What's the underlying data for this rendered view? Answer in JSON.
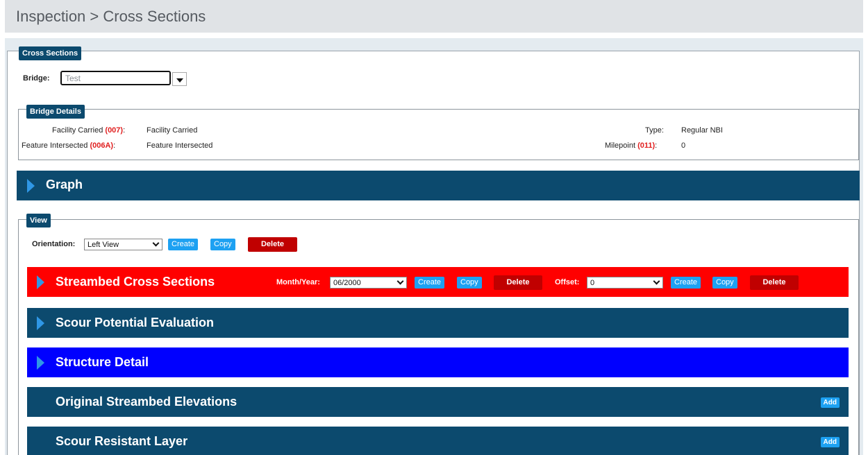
{
  "breadcrumb": "Inspection > Cross Sections",
  "cross_sections": {
    "legend": "Cross Sections",
    "bridge_label": "Bridge:",
    "bridge_value": "Test"
  },
  "bridge_details": {
    "legend": "Bridge Details",
    "facility_carried_label": "Facility Carried ",
    "facility_carried_code": "(007)",
    "facility_carried_value": "Facility Carried",
    "feature_intersected_label": "Feature Intersected ",
    "feature_intersected_code": "(006A)",
    "feature_intersected_value": "Feature Intersected",
    "type_label": "Type:",
    "type_value": "Regular NBI",
    "milepoint_label": "Milepoint ",
    "milepoint_code": "(011)",
    "milepoint_value": "0",
    "colon": ":"
  },
  "graph": {
    "title": "Graph"
  },
  "view": {
    "legend": "View",
    "orientation_label": "Orientation:",
    "orientation_value": "Left View",
    "create": "Create",
    "copy": "Copy",
    "delete": "Delete"
  },
  "streambed": {
    "title": "Streambed Cross Sections",
    "month_year_label": "Month/Year:",
    "month_year_value": "06/2000",
    "offset_label": "Offset:",
    "offset_value": "0",
    "create": "Create",
    "copy": "Copy",
    "delete": "Delete"
  },
  "sections": {
    "scour_potential": "Scour Potential Evaluation",
    "structure_detail": "Structure Detail",
    "original_streambed": "Original Streambed Elevations",
    "scour_resistant": "Scour Resistant Layer",
    "add": "Add"
  },
  "colors": {
    "navy": "#0c4a6e",
    "red": "#ff0000",
    "blue": "#0000ff",
    "accent": "#1da1f2",
    "danger": "#c00000"
  }
}
